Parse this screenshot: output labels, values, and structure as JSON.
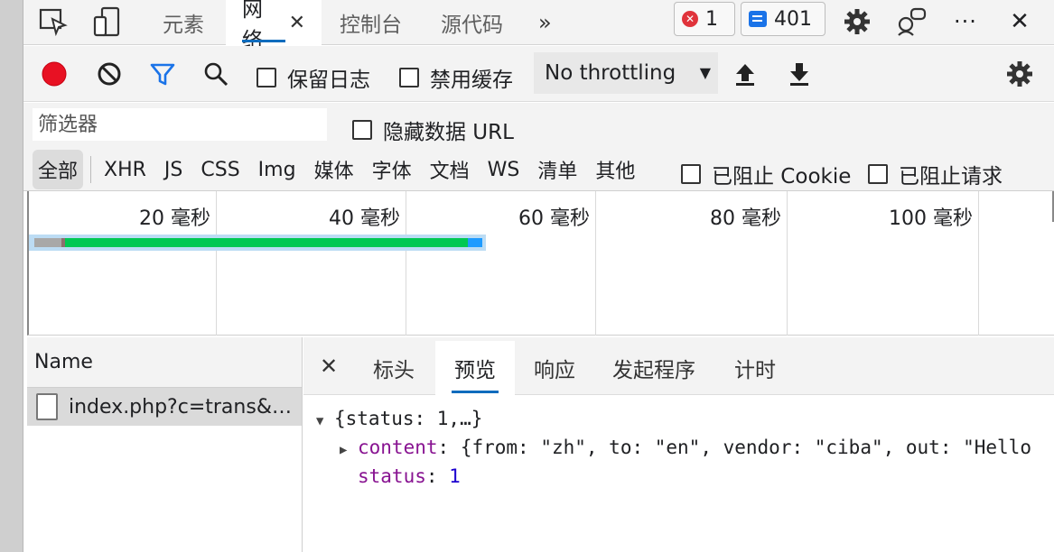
{
  "tabs": [
    {
      "label": "元素"
    },
    {
      "label": "网络",
      "close": "✕"
    },
    {
      "label": "控制台"
    },
    {
      "label": "源代码"
    }
  ],
  "more_tabs": "»",
  "errors_count": "1",
  "messages_count": "401",
  "more_menu": "···",
  "close_devtools": "✕",
  "toolbar": {
    "preserve_log": "保留日志",
    "disable_cache": "禁用缓存",
    "throttling": "No throttling"
  },
  "filter": {
    "placeholder": "筛选器",
    "hide_data_urls": "隐藏数据 URL",
    "types": [
      "全部",
      "XHR",
      "JS",
      "CSS",
      "Img",
      "媒体",
      "字体",
      "文档",
      "WS",
      "清单",
      "其他"
    ],
    "blocked_cookies": "已阻止 Cookie",
    "blocked_requests": "已阻止请求"
  },
  "timeline": {
    "ticks": [
      "20 毫秒",
      "40 毫秒",
      "60 毫秒",
      "80 毫秒",
      "100 毫秒"
    ]
  },
  "requests": {
    "header": "Name",
    "rows": [
      "index.php?c=trans&…"
    ]
  },
  "details": {
    "close": "✕",
    "tabs": [
      "标头",
      "预览",
      "响应",
      "发起程序",
      "计时"
    ],
    "preview": {
      "summary": "{status: 1,…}",
      "content_key": "content",
      "content_value": "{from: \"zh\", to: \"en\", vendor: \"ciba\", out: \"Hello",
      "status_key": "status",
      "status_value": "1"
    }
  },
  "colors": {
    "record": "#e81123",
    "filter_active": "#1a73e8",
    "accent": "#0f6cbd",
    "waterfall_waiting": "#00c853",
    "waterfall_download": "#1e9bff"
  }
}
